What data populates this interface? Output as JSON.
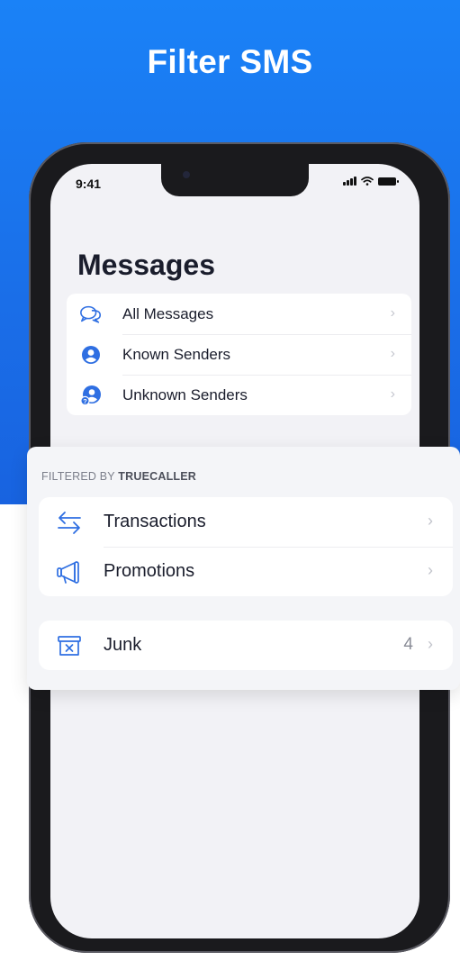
{
  "headline": "Filter SMS",
  "status_bar": {
    "time": "9:41"
  },
  "messages": {
    "title": "Messages",
    "items": [
      {
        "label": "All Messages",
        "icon": "chat-bubbles-icon"
      },
      {
        "label": "Known Senders",
        "icon": "person-circle-icon"
      },
      {
        "label": "Unknown Senders",
        "icon": "unknown-person-icon"
      }
    ]
  },
  "filtered": {
    "label_prefix": "FILTERED BY ",
    "label_brand": "TRUECALLER",
    "items": [
      {
        "label": "Transactions",
        "icon": "arrows-exchange-icon"
      },
      {
        "label": "Promotions",
        "icon": "megaphone-icon"
      }
    ],
    "junk": {
      "label": "Junk",
      "count": "4",
      "icon": "junk-box-icon"
    }
  },
  "colors": {
    "background_blue": "#1a6ee8",
    "icon_blue": "#2f6fe2",
    "text_dark": "#1a1d2c"
  }
}
